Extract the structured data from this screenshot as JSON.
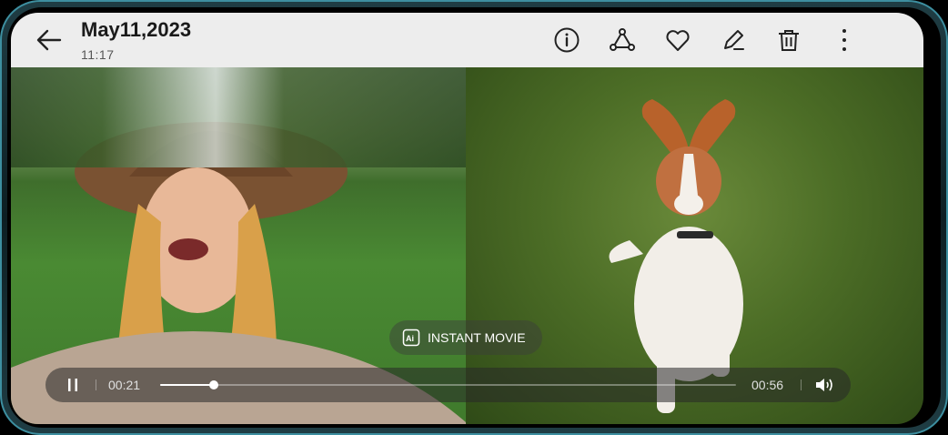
{
  "header": {
    "title": "May11,2023",
    "time": "11:17"
  },
  "toolbar": {
    "icons": [
      "back-arrow-icon",
      "info-icon",
      "share-icon",
      "heart-icon",
      "edit-icon",
      "trash-icon",
      "more-icon"
    ]
  },
  "instant_movie": {
    "label": "INSTANT MOVIE"
  },
  "player": {
    "elapsed": "00:21",
    "duration": "00:56",
    "progress": 0.093
  },
  "colors": {
    "topbar_bg": "#f5f5f5",
    "frame_accent": "#3d8fa0"
  }
}
